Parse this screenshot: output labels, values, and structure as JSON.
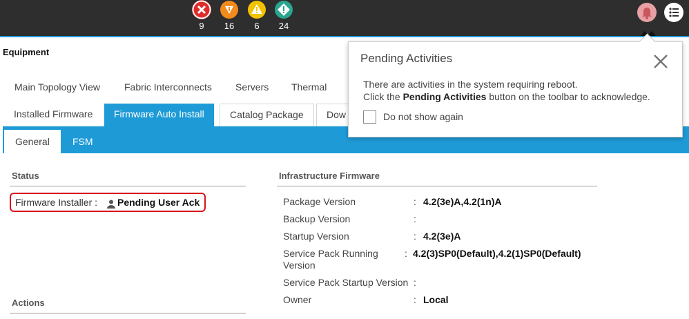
{
  "header": {
    "status_counts": [
      {
        "name": "critical",
        "count": "9",
        "color": "#e02b2b",
        "symbol": "✕"
      },
      {
        "name": "major",
        "count": "16",
        "color": "#f28a1c",
        "symbol": "▼"
      },
      {
        "name": "minor",
        "count": "6",
        "color": "#f2c300",
        "symbol": "!"
      },
      {
        "name": "warning",
        "count": "24",
        "color": "#2aa58f",
        "symbol": "!"
      }
    ],
    "accent": "#1e9bd7"
  },
  "section_title": "Equipment",
  "tabs_primary": [
    "Main Topology View",
    "Fabric Interconnects",
    "Servers",
    "Thermal"
  ],
  "tabs_secondary": [
    "Installed Firmware",
    "Firmware Auto Install",
    "Catalog Package",
    "Dow"
  ],
  "tabs_sub": [
    "General",
    "FSM"
  ],
  "status": {
    "heading": "Status",
    "firmware_installer_label": "Firmware Installer :",
    "firmware_installer_value": "Pending User Ack"
  },
  "actions_heading": "Actions",
  "infra": {
    "heading": "Infrastructure Firmware",
    "rows": [
      {
        "label": "Package Version",
        "value": "4.2(3e)A,4.2(1n)A"
      },
      {
        "label": "Backup Version",
        "value": ""
      },
      {
        "label": "Startup Version",
        "value": "4.2(3e)A"
      },
      {
        "label": "Service Pack Running",
        "label2": "Version",
        "value": "4.2(3)SP0(Default),4.2(1)SP0(Default)"
      },
      {
        "label": "Service Pack Startup Version",
        "value": ""
      },
      {
        "label": "Owner",
        "value": "Local"
      }
    ]
  },
  "popup": {
    "title": "Pending Activities",
    "message_line1": "There are activities in the system requiring reboot.",
    "message_pre": "Click the",
    "message_bold": "Pending Activities",
    "message_post": "button on the toolbar to acknowledge.",
    "checkbox_label": "Do not show again"
  }
}
